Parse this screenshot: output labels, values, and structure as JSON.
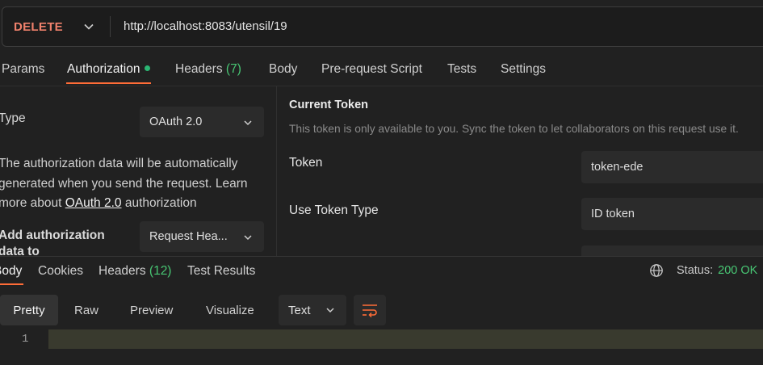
{
  "request": {
    "method": "DELETE",
    "url": "http://localhost:8083/utensil/19"
  },
  "request_tabs": [
    {
      "label": "Params"
    },
    {
      "label": "Authorization",
      "active": true,
      "indicator": "green-dot"
    },
    {
      "label": "Headers",
      "count": "(7)"
    },
    {
      "label": "Body"
    },
    {
      "label": "Pre-request Script"
    },
    {
      "label": "Tests"
    },
    {
      "label": "Settings"
    }
  ],
  "auth": {
    "type_label": "Type",
    "type_value": "OAuth 2.0",
    "desc_part1": "The authorization data will be automatically generated when you send the request. Learn more about ",
    "desc_link": "OAuth 2.0",
    "desc_part2": " authorization",
    "add_to_label": "Add authorization data to",
    "add_to_value": "Request Hea..."
  },
  "current_token": {
    "title": "Current Token",
    "note": "This token is only available to you. Sync the token to let collaborators on this request use it.",
    "token_label": "Token",
    "token_value": "token-ede",
    "use_token_type_label": "Use Token Type",
    "use_token_type_value": "ID token"
  },
  "response_tabs": [
    {
      "label": "Body",
      "active": true
    },
    {
      "label": "Cookies"
    },
    {
      "label": "Headers",
      "count": "(12)"
    },
    {
      "label": "Test Results"
    }
  ],
  "status": {
    "label": "Status:",
    "code": "200 OK"
  },
  "view_modes": [
    "Pretty",
    "Raw",
    "Preview",
    "Visualize"
  ],
  "format": "Text",
  "editor": {
    "line_numbers": [
      "1"
    ]
  },
  "colors": {
    "accent": "#ff6c37",
    "method_delete": "#f0816c",
    "success": "#48c774",
    "background": "#212121"
  },
  "icons": [
    "chevron-down-icon",
    "globe-icon",
    "wrap-lines-icon"
  ]
}
